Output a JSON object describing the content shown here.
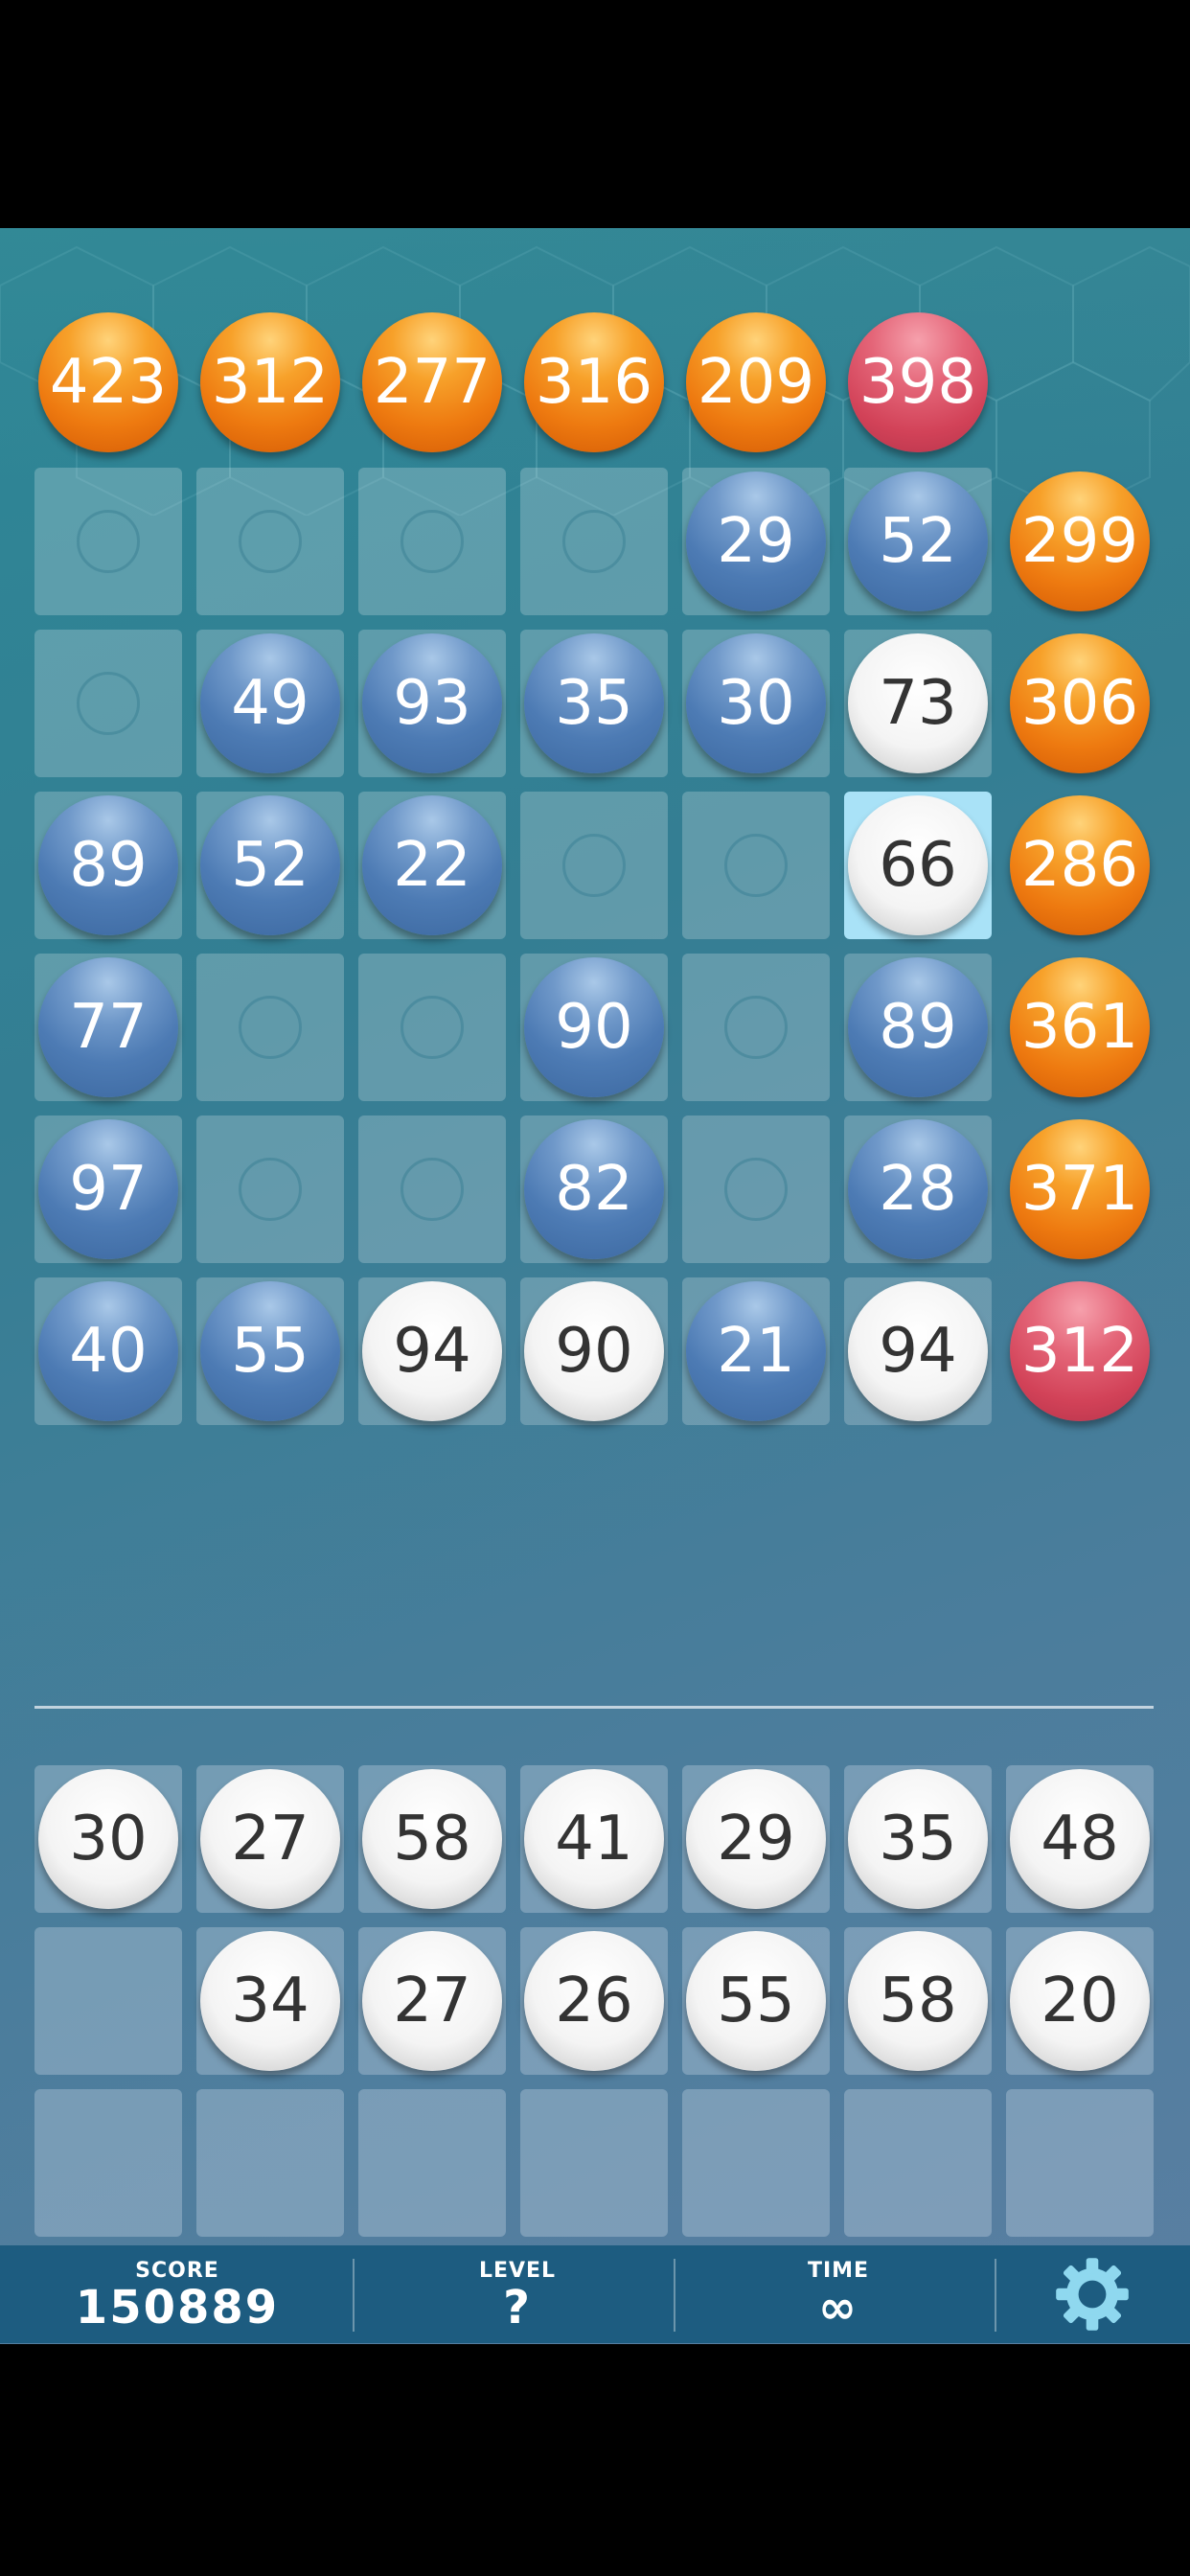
{
  "targets_top": [
    {
      "value": "423",
      "color": "orange"
    },
    {
      "value": "312",
      "color": "orange"
    },
    {
      "value": "277",
      "color": "orange"
    },
    {
      "value": "316",
      "color": "orange"
    },
    {
      "value": "209",
      "color": "orange"
    },
    {
      "value": "398",
      "color": "red"
    }
  ],
  "targets_right": [
    {
      "value": "299",
      "color": "orange"
    },
    {
      "value": "306",
      "color": "orange"
    },
    {
      "value": "286",
      "color": "orange"
    },
    {
      "value": "361",
      "color": "orange"
    },
    {
      "value": "371",
      "color": "orange"
    },
    {
      "value": "312",
      "color": "red"
    }
  ],
  "grid": [
    [
      null,
      null,
      null,
      null,
      {
        "value": "29",
        "color": "blue"
      },
      {
        "value": "52",
        "color": "blue"
      }
    ],
    [
      null,
      {
        "value": "49",
        "color": "blue"
      },
      {
        "value": "93",
        "color": "blue"
      },
      {
        "value": "35",
        "color": "blue"
      },
      {
        "value": "30",
        "color": "blue"
      },
      {
        "value": "73",
        "color": "white"
      }
    ],
    [
      {
        "value": "89",
        "color": "blue"
      },
      {
        "value": "52",
        "color": "blue"
      },
      {
        "value": "22",
        "color": "blue"
      },
      null,
      null,
      {
        "value": "66",
        "color": "white",
        "selected": true
      }
    ],
    [
      {
        "value": "77",
        "color": "blue"
      },
      null,
      null,
      {
        "value": "90",
        "color": "blue"
      },
      null,
      {
        "value": "89",
        "color": "blue"
      }
    ],
    [
      {
        "value": "97",
        "color": "blue"
      },
      null,
      null,
      {
        "value": "82",
        "color": "blue"
      },
      null,
      {
        "value": "28",
        "color": "blue"
      }
    ],
    [
      {
        "value": "40",
        "color": "blue"
      },
      {
        "value": "55",
        "color": "blue"
      },
      {
        "value": "94",
        "color": "white"
      },
      {
        "value": "90",
        "color": "white"
      },
      {
        "value": "21",
        "color": "blue"
      },
      {
        "value": "94",
        "color": "white"
      }
    ]
  ],
  "tray": [
    [
      "30",
      "27",
      "58",
      "41",
      "29",
      "35",
      "48"
    ],
    [
      null,
      "34",
      "27",
      "26",
      "55",
      "58",
      "20"
    ],
    [
      null,
      null,
      null,
      null,
      null,
      null,
      null
    ]
  ],
  "status_bar": {
    "score_label": "SCORE",
    "score_value": "150889",
    "level_label": "LEVEL",
    "level_value": "?",
    "time_label": "TIME",
    "time_value": "∞",
    "settings_icon": "gear-icon"
  }
}
